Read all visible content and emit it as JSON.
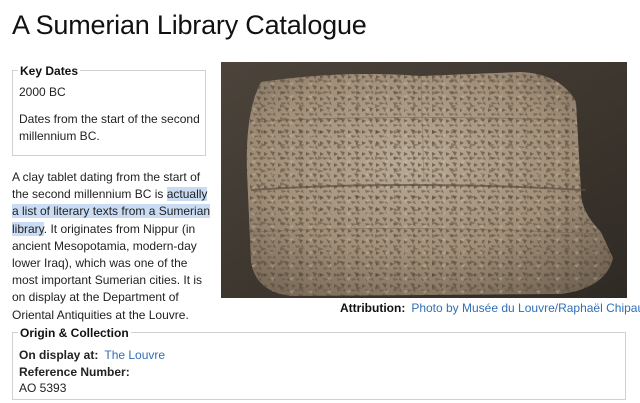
{
  "page": {
    "title": "A Sumerian Library Catalogue"
  },
  "key_dates": {
    "heading": "Key Dates",
    "date": "2000 BC",
    "description": "Dates from the start of the second millennium BC."
  },
  "body": {
    "text_before": "A clay tablet dating from the start of the second millennium BC is ",
    "highlighted": "actually a list of literary texts from a Sumerian library",
    "text_after": ". It originates from Nippur (in ancient Mesopotamia, modern-day lower Iraq), which was one of the most important Sumerian cities. It is on display at the Department of Oriental Antiquities at the Louvre."
  },
  "image": {
    "attribution_label": "Attribution:",
    "attribution_link": "Photo by Musée du Louvre/Raphaël Chipault",
    "icon": "external-link-icon"
  },
  "origin": {
    "heading": "Origin & Collection",
    "display_label": "On display at:",
    "display_value": "The Louvre",
    "reference_label": "Reference Number:",
    "reference_value": "AO 5393"
  },
  "colors": {
    "link": "#2f6fb6",
    "highlight": "#c9dcf3",
    "photo_background": "#453d35"
  }
}
